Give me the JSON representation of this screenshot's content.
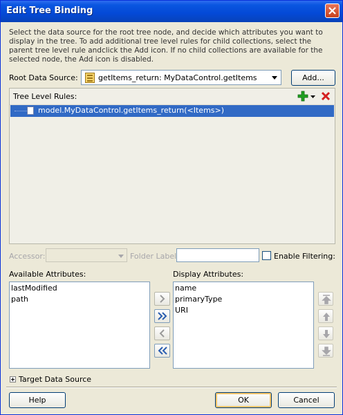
{
  "dialog": {
    "title": "Edit Tree Binding",
    "description": "Select the data source for the root tree node, and decide which attributes you want to display in the tree. To add additional tree level rules for child collections, select the parent tree level rule andclick the Add icon. If no child collections are available for the selected node, the Add icon is disabled."
  },
  "root_source": {
    "label": "Root Data Source:",
    "value": "getItems_return:  MyDataControl.getItems",
    "add_button": "Add..."
  },
  "tree_rules": {
    "label": "Tree Level Rules:",
    "rows": [
      "model.MyDataControl.getItems_return(<Items>)"
    ]
  },
  "accessor": {
    "label": "Accessor:",
    "folder_label": "Folder Label:",
    "enable_filtering": "Enable Filtering:"
  },
  "available": {
    "label": "Available Attributes:",
    "items": [
      "lastModified",
      "path"
    ]
  },
  "display": {
    "label": "Display Attributes:",
    "items": [
      "name",
      "primaryType",
      "URI"
    ]
  },
  "target": {
    "label": "Target Data Source"
  },
  "footer": {
    "help": "Help",
    "ok": "OK",
    "cancel": "Cancel"
  },
  "colors": {
    "titlebar": "#0449d6",
    "selection": "#316ac5",
    "dialog_bg": "#ece9d8",
    "add_icon": "#21a121",
    "delete_icon": "#d42020"
  }
}
